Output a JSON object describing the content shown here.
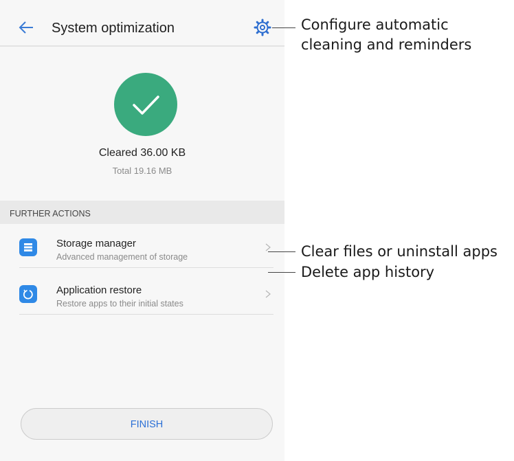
{
  "header": {
    "title": "System optimization"
  },
  "result": {
    "cleared": "Cleared 36.00 KB",
    "total": "Total 19.16 MB"
  },
  "section": {
    "title": "FURTHER ACTIONS"
  },
  "actions": [
    {
      "label": "Storage manager",
      "sub": "Advanced management of storage",
      "icon": "storage-icon"
    },
    {
      "label": "Application restore",
      "sub": "Restore apps to their initial states",
      "icon": "restore-icon"
    }
  ],
  "finish_label": "FINISH",
  "callouts": {
    "settings": "Configure automatic cleaning and reminders",
    "storage": "Clear files or uninstall apps",
    "restore": "Delete app history"
  },
  "colors": {
    "success": "#3aaa7e",
    "icon_blue": "#2f89e6",
    "accent": "#2a6fd6"
  }
}
